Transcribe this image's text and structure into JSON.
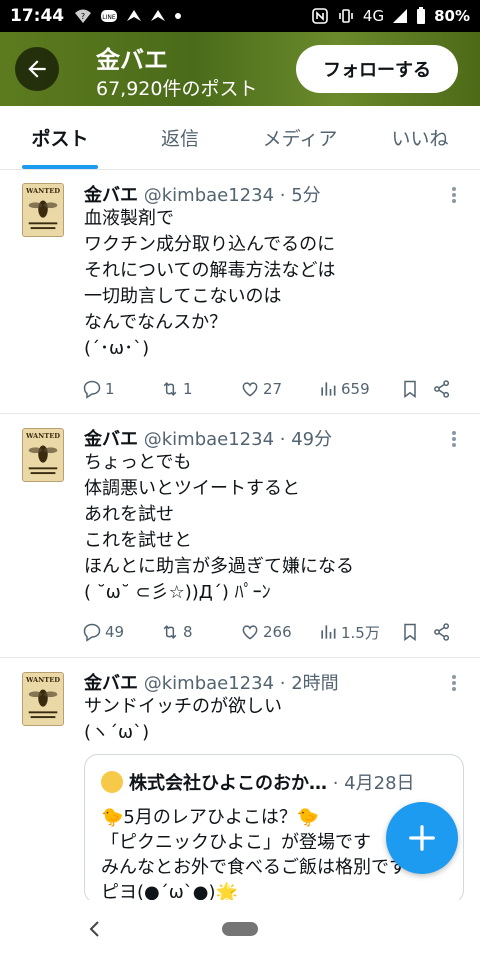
{
  "status_bar": {
    "time": "17:44",
    "notif_icons": [
      "wifi-question-icon",
      "line-app-icon",
      "send-icon",
      "send-icon",
      "dot-icon"
    ],
    "network": "4G",
    "battery": "80%"
  },
  "header": {
    "title": "金バエ",
    "post_count": "67,920件のポスト",
    "follow_label": "フォローする"
  },
  "tabs": [
    {
      "label": "ポスト",
      "active": true
    },
    {
      "label": "返信"
    },
    {
      "label": "メディア"
    },
    {
      "label": "いいね"
    }
  ],
  "tweets": [
    {
      "name": "金バエ",
      "handle": "@kimbae1234",
      "time": "· 5分",
      "text": "血液製剤で\nワクチン成分取り込んでるのに\nそれについての解毒方法などは\n一切助言してこないのは\nなんでなんスか？\n(´･ω･`)",
      "replies": "1",
      "reposts": "1",
      "likes": "27",
      "views": "659"
    },
    {
      "name": "金バエ",
      "handle": "@kimbae1234",
      "time": "· 49分",
      "text": "ちょっとでも\n体調悪いとツイートすると\nあれを試せ\nこれを試せと\nほんとに助言が多過ぎて嫌になる\n( ˘ω˘ ⊂彡☆))Д´) ﾊﾟｰﾝ",
      "replies": "49",
      "reposts": "8",
      "likes": "266",
      "views": "1.5万"
    },
    {
      "name": "金バエ",
      "handle": "@kimbae1234",
      "time": "· 2時間",
      "text": "サンドイッチのが欲しい\n(ヽ´ω`)",
      "quote": {
        "name": "株式会社ひよこのおか…",
        "date": "· 4月28日",
        "text": "🐤5月のレアひよこは？🐤\n「ピクニックひよこ」が登場です\nみんなとお外で食べるご飯は格別です\nピヨ(●´ω`●)🌟"
      }
    }
  ],
  "accent_color": "#1d9bf0"
}
